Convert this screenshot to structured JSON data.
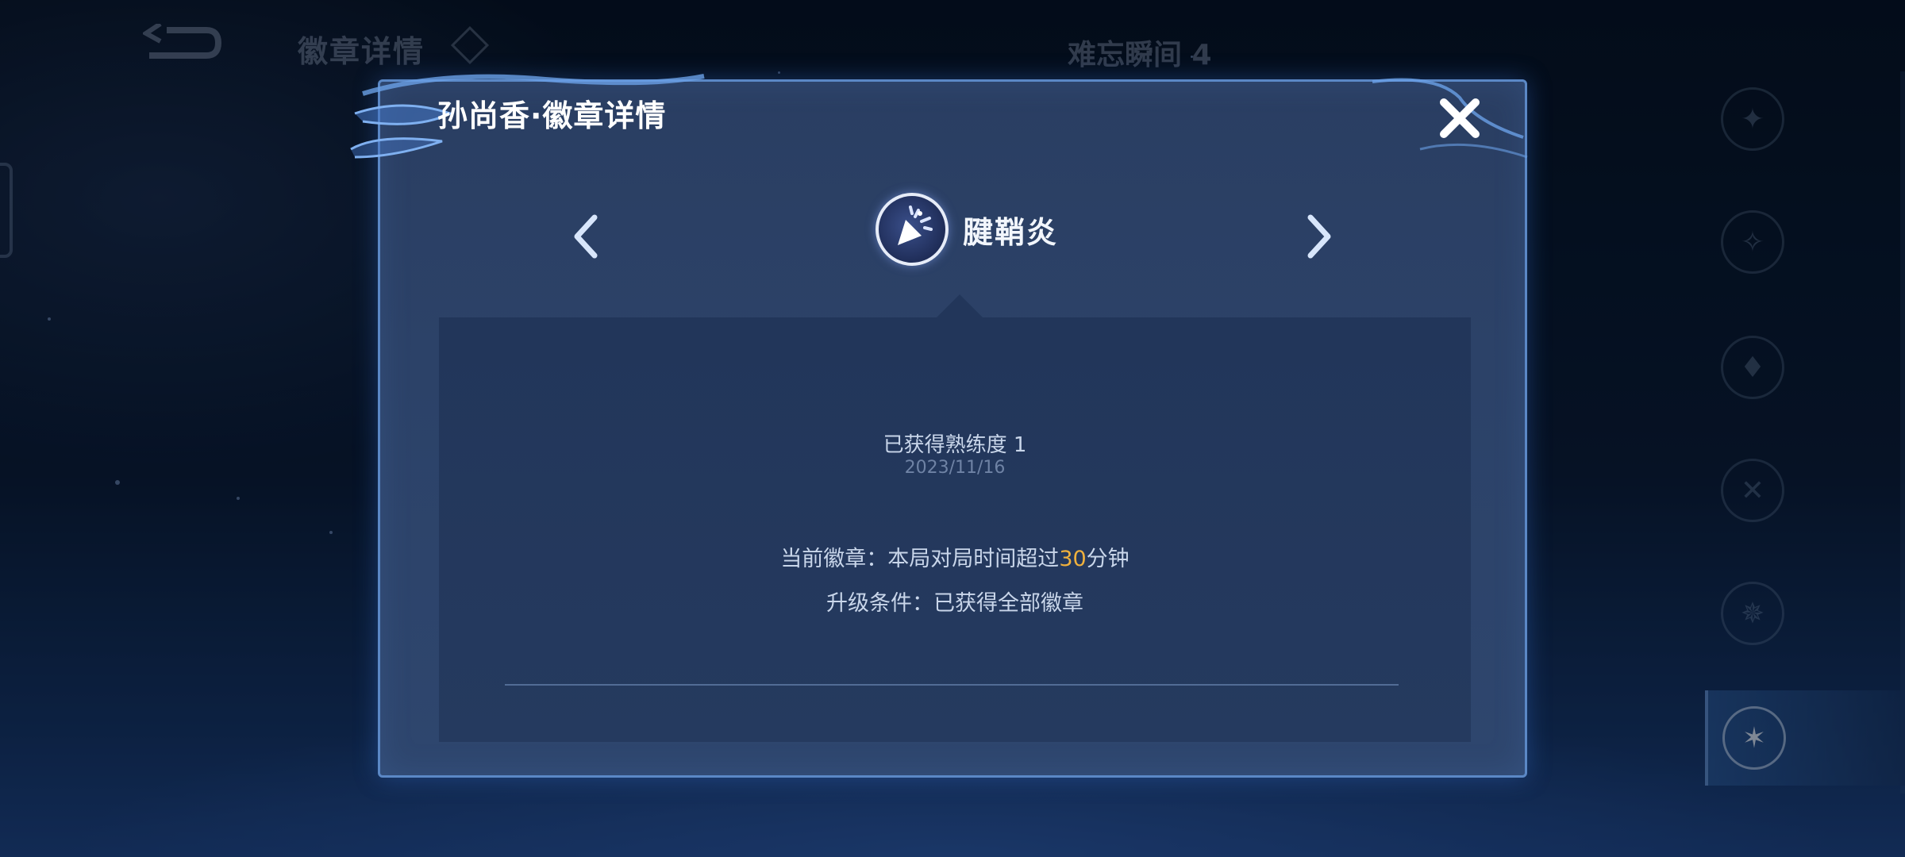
{
  "background": {
    "title": "徽章详情",
    "subtitle": "难忘瞬间 4",
    "sidebar_icons": [
      "badge-icon-1",
      "badge-icon-2",
      "badge-icon-3",
      "badge-icon-4",
      "badge-icon-5",
      "badge-icon-6-active"
    ]
  },
  "modal": {
    "title": "孙尚香·徽章详情",
    "close_icon": "close-icon",
    "badge": {
      "name": "腱鞘炎",
      "icon": "firework-badge-icon"
    },
    "proficiency": "已获得熟练度 1",
    "date": "2023/11/16",
    "current_badge_prefix": "当前徽章：本局对局时间超过",
    "current_badge_value": "30",
    "current_badge_suffix": "分钟",
    "upgrade_condition": "升级条件：已获得全部徽章"
  },
  "colors": {
    "accent_orange": "#f0b13d",
    "modal_border": "#5b88c6",
    "modal_bg": "#2c4268"
  }
}
